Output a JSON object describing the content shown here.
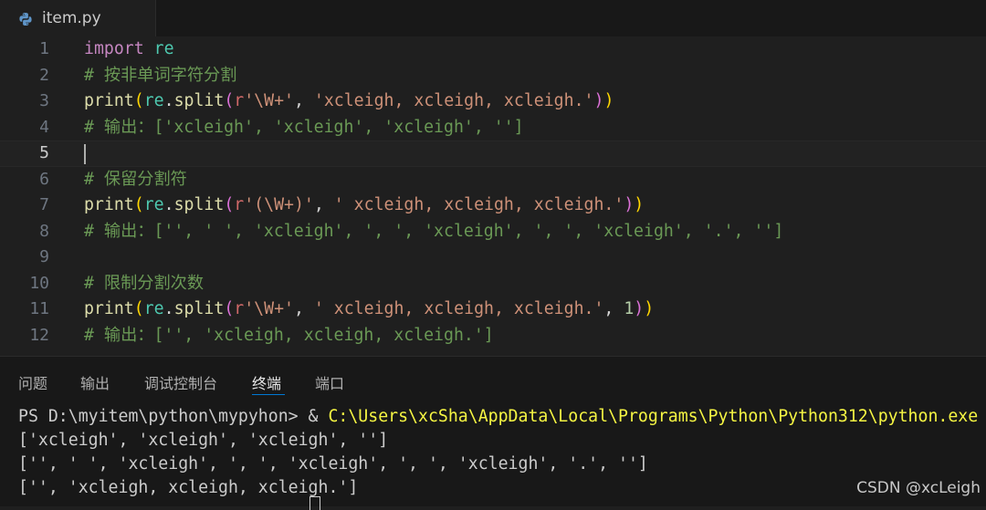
{
  "tab": {
    "filename": "item.py",
    "icon": "python-icon"
  },
  "editor": {
    "active_line": 5,
    "lines": [
      {
        "n": "1",
        "tokens": [
          [
            "k",
            "import"
          ],
          [
            "op",
            " "
          ],
          [
            "mod",
            "re"
          ]
        ]
      },
      {
        "n": "2",
        "tokens": [
          [
            "cm",
            "# 按非单词字符分割"
          ]
        ]
      },
      {
        "n": "3",
        "tokens": [
          [
            "fn",
            "print"
          ],
          [
            "b1",
            "("
          ],
          [
            "mod",
            "re"
          ],
          [
            "op",
            "."
          ],
          [
            "fn",
            "split"
          ],
          [
            "b2",
            "("
          ],
          [
            "re",
            "r"
          ],
          [
            "str",
            "'\\W+'"
          ],
          [
            "op",
            ", "
          ],
          [
            "str",
            "'xcleigh, xcleigh, xcleigh.'"
          ],
          [
            "b2",
            ")"
          ],
          [
            "b1",
            ")"
          ]
        ]
      },
      {
        "n": "4",
        "tokens": [
          [
            "cm",
            "# 输出：['xcleigh', 'xcleigh', 'xcleigh', '']"
          ]
        ]
      },
      {
        "n": "5",
        "tokens": []
      },
      {
        "n": "6",
        "tokens": [
          [
            "cm",
            "# 保留分割符"
          ]
        ]
      },
      {
        "n": "7",
        "tokens": [
          [
            "fn",
            "print"
          ],
          [
            "b1",
            "("
          ],
          [
            "mod",
            "re"
          ],
          [
            "op",
            "."
          ],
          [
            "fn",
            "split"
          ],
          [
            "b2",
            "("
          ],
          [
            "re",
            "r"
          ],
          [
            "str",
            "'(\\W+)'"
          ],
          [
            "op",
            ", "
          ],
          [
            "str",
            "' xcleigh, xcleigh, xcleigh.'"
          ],
          [
            "b2",
            ")"
          ],
          [
            "b1",
            ")"
          ]
        ]
      },
      {
        "n": "8",
        "tokens": [
          [
            "cm",
            "# 输出：['', ' ', 'xcleigh', ', ', 'xcleigh', ', ', 'xcleigh', '.', '']"
          ]
        ]
      },
      {
        "n": "9",
        "tokens": []
      },
      {
        "n": "10",
        "tokens": [
          [
            "cm",
            "# 限制分割次数"
          ]
        ]
      },
      {
        "n": "11",
        "tokens": [
          [
            "fn",
            "print"
          ],
          [
            "b1",
            "("
          ],
          [
            "mod",
            "re"
          ],
          [
            "op",
            "."
          ],
          [
            "fn",
            "split"
          ],
          [
            "b2",
            "("
          ],
          [
            "re",
            "r"
          ],
          [
            "str",
            "'\\W+'"
          ],
          [
            "op",
            ", "
          ],
          [
            "str",
            "' xcleigh, xcleigh, xcleigh.'"
          ],
          [
            "op",
            ", "
          ],
          [
            "num",
            "1"
          ],
          [
            "b2",
            ")"
          ],
          [
            "b1",
            ")"
          ]
        ]
      },
      {
        "n": "12",
        "tokens": [
          [
            "cm",
            "# 输出：['', 'xcleigh, xcleigh, xcleigh.']"
          ]
        ]
      }
    ]
  },
  "panel": {
    "tabs": [
      "问题",
      "输出",
      "调试控制台",
      "终端",
      "端口"
    ],
    "active_tab": "终端"
  },
  "terminal": {
    "prompt": "PS D:\\myitem\\python\\mypyhon> & ",
    "command": "C:\\Users\\xcSha\\AppData\\Local\\Programs\\Python\\Python312\\python.exe",
    "output": [
      "['xcleigh', 'xcleigh', 'xcleigh', '']",
      "['', ' ', 'xcleigh', ', ', 'xcleigh', ', ', 'xcleigh', '.', '']",
      "['', 'xcleigh, xcleigh, xcleigh.']"
    ]
  },
  "watermark": "CSDN @xcLeigh",
  "colors": {
    "editor_bg": "#1f1f1f",
    "panel_bg": "#181818",
    "accent": "#0078d4",
    "terminal_command": "#f5f543"
  }
}
